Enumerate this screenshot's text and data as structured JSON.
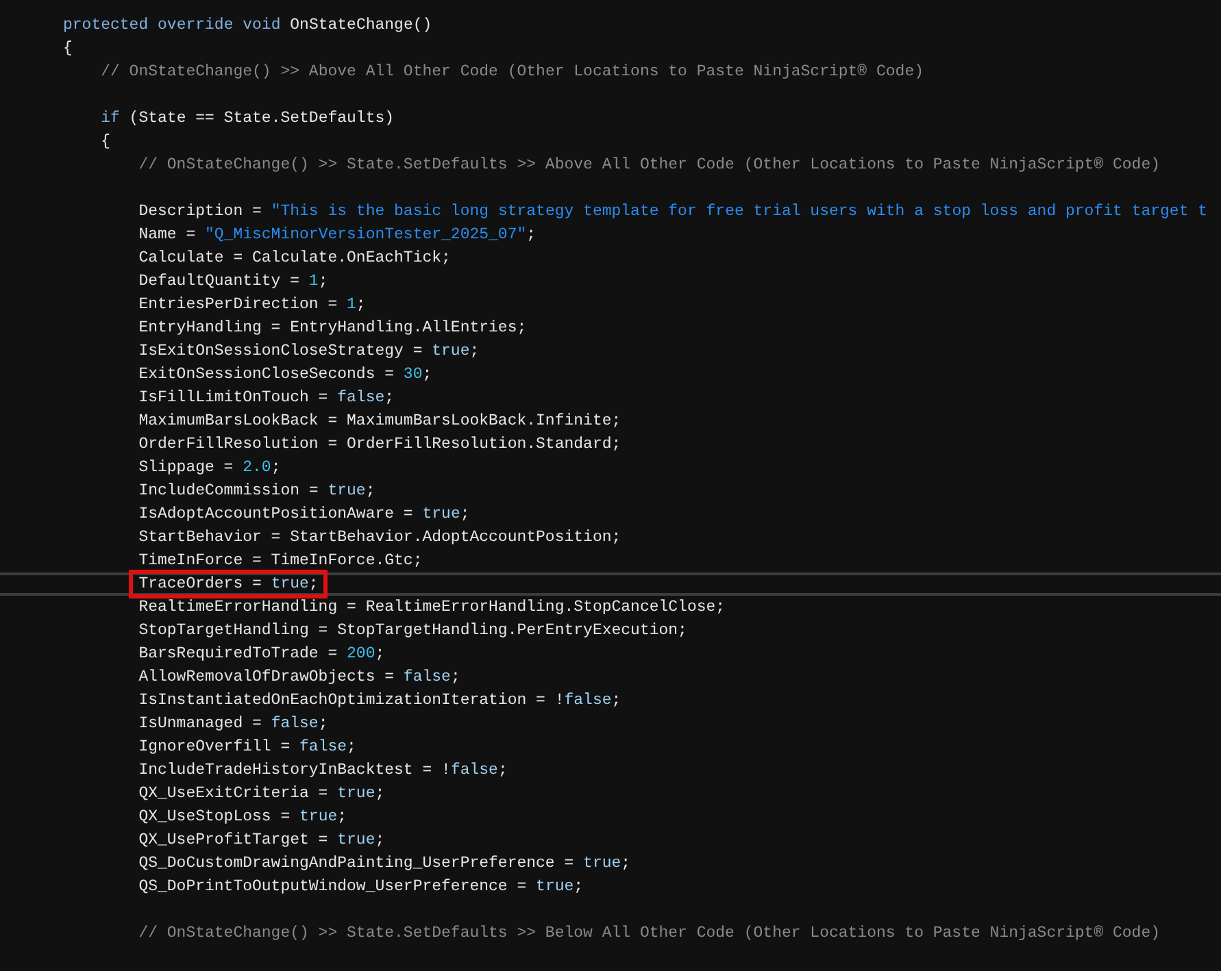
{
  "editor": {
    "lines": [
      {
        "kind": "code",
        "current": false,
        "marked": false,
        "tokens": [
          {
            "kind": "keyword",
            "text": "protected override void"
          },
          {
            "kind": "plain",
            "text": " OnStateChange()"
          }
        ]
      },
      {
        "kind": "code",
        "current": false,
        "marked": false,
        "tokens": [
          {
            "kind": "plain",
            "text": "{"
          }
        ],
        "children": [
          {
            "kind": "code",
            "current": false,
            "marked": false,
            "tokens": [
              {
                "kind": "comment",
                "text": "// OnStateChange() >> Above All Other Code (Other Locations to Paste NinjaScript® Code)"
              }
            ]
          },
          {
            "kind": "blank",
            "current": false,
            "marked": false
          },
          {
            "kind": "code",
            "current": false,
            "marked": false,
            "tokens": [
              {
                "kind": "keyword",
                "text": "if"
              },
              {
                "kind": "plain",
                "text": " (State == State.SetDefaults)"
              }
            ]
          },
          {
            "kind": "code",
            "current": false,
            "marked": false,
            "tokens": [
              {
                "kind": "plain",
                "text": "{"
              }
            ],
            "children": [
              {
                "kind": "code",
                "current": false,
                "marked": false,
                "tokens": [
                  {
                    "kind": "comment",
                    "text": "// OnStateChange() >> State.SetDefaults >> Above All Other Code (Other Locations to Paste NinjaScript® Code)"
                  }
                ]
              },
              {
                "kind": "blank",
                "current": false,
                "marked": false
              },
              {
                "kind": "code",
                "current": false,
                "marked": false,
                "tokens": [
                  {
                    "kind": "plain",
                    "text": "Description = "
                  },
                  {
                    "kind": "string",
                    "text": "\"This is the basic long strategy template for free trial users with a stop loss and profit target t"
                  }
                ]
              },
              {
                "kind": "code",
                "current": false,
                "marked": false,
                "tokens": [
                  {
                    "kind": "plain",
                    "text": "Name = "
                  },
                  {
                    "kind": "string",
                    "text": "\"Q_MiscMinorVersionTester_2025_07\""
                  },
                  {
                    "kind": "plain",
                    "text": ";"
                  }
                ]
              },
              {
                "kind": "code",
                "current": false,
                "marked": false,
                "tokens": [
                  {
                    "kind": "plain",
                    "text": "Calculate = Calculate.OnEachTick;"
                  }
                ]
              },
              {
                "kind": "code",
                "current": false,
                "marked": false,
                "tokens": [
                  {
                    "kind": "plain",
                    "text": "DefaultQuantity = "
                  },
                  {
                    "kind": "number",
                    "text": "1"
                  },
                  {
                    "kind": "plain",
                    "text": ";"
                  }
                ]
              },
              {
                "kind": "code",
                "current": false,
                "marked": false,
                "tokens": [
                  {
                    "kind": "plain",
                    "text": "EntriesPerDirection = "
                  },
                  {
                    "kind": "number",
                    "text": "1"
                  },
                  {
                    "kind": "plain",
                    "text": ";"
                  }
                ]
              },
              {
                "kind": "code",
                "current": false,
                "marked": false,
                "tokens": [
                  {
                    "kind": "plain",
                    "text": "EntryHandling = EntryHandling.AllEntries;"
                  }
                ]
              },
              {
                "kind": "code",
                "current": false,
                "marked": false,
                "tokens": [
                  {
                    "kind": "plain",
                    "text": "IsExitOnSessionCloseStrategy = "
                  },
                  {
                    "kind": "literal",
                    "text": "true"
                  },
                  {
                    "kind": "plain",
                    "text": ";"
                  }
                ]
              },
              {
                "kind": "code",
                "current": false,
                "marked": false,
                "tokens": [
                  {
                    "kind": "plain",
                    "text": "ExitOnSessionCloseSeconds = "
                  },
                  {
                    "kind": "number",
                    "text": "30"
                  },
                  {
                    "kind": "plain",
                    "text": ";"
                  }
                ]
              },
              {
                "kind": "code",
                "current": false,
                "marked": false,
                "tokens": [
                  {
                    "kind": "plain",
                    "text": "IsFillLimitOnTouch = "
                  },
                  {
                    "kind": "literal",
                    "text": "false"
                  },
                  {
                    "kind": "plain",
                    "text": ";"
                  }
                ]
              },
              {
                "kind": "code",
                "current": false,
                "marked": false,
                "tokens": [
                  {
                    "kind": "plain",
                    "text": "MaximumBarsLookBack = MaximumBarsLookBack.Infinite;"
                  }
                ]
              },
              {
                "kind": "code",
                "current": false,
                "marked": false,
                "tokens": [
                  {
                    "kind": "plain",
                    "text": "OrderFillResolution = OrderFillResolution.Standard;"
                  }
                ]
              },
              {
                "kind": "code",
                "current": false,
                "marked": false,
                "tokens": [
                  {
                    "kind": "plain",
                    "text": "Slippage = "
                  },
                  {
                    "kind": "number",
                    "text": "2.0"
                  },
                  {
                    "kind": "plain",
                    "text": ";"
                  }
                ]
              },
              {
                "kind": "code",
                "current": false,
                "marked": false,
                "tokens": [
                  {
                    "kind": "plain",
                    "text": "IncludeCommission = "
                  },
                  {
                    "kind": "literal",
                    "text": "true"
                  },
                  {
                    "kind": "plain",
                    "text": ";"
                  }
                ]
              },
              {
                "kind": "code",
                "current": false,
                "marked": false,
                "tokens": [
                  {
                    "kind": "plain",
                    "text": "IsAdoptAccountPositionAware = "
                  },
                  {
                    "kind": "literal",
                    "text": "true"
                  },
                  {
                    "kind": "plain",
                    "text": ";"
                  }
                ]
              },
              {
                "kind": "code",
                "current": false,
                "marked": false,
                "tokens": [
                  {
                    "kind": "plain",
                    "text": "StartBehavior = StartBehavior.AdoptAccountPosition;"
                  }
                ]
              },
              {
                "kind": "code",
                "current": false,
                "marked": false,
                "tokens": [
                  {
                    "kind": "plain",
                    "text": "TimeInForce = TimeInForce.Gtc;"
                  }
                ]
              },
              {
                "kind": "code",
                "current": true,
                "marked": true,
                "tokens": [
                  {
                    "kind": "plain",
                    "text": "TraceOrders = "
                  },
                  {
                    "kind": "literal",
                    "text": "true"
                  },
                  {
                    "kind": "plain",
                    "text": ";"
                  }
                ]
              },
              {
                "kind": "code",
                "current": false,
                "marked": false,
                "tokens": [
                  {
                    "kind": "plain",
                    "text": "RealtimeErrorHandling = RealtimeErrorHandling.StopCancelClose;"
                  }
                ]
              },
              {
                "kind": "code",
                "current": false,
                "marked": false,
                "tokens": [
                  {
                    "kind": "plain",
                    "text": "StopTargetHandling = StopTargetHandling.PerEntryExecution;"
                  }
                ]
              },
              {
                "kind": "code",
                "current": false,
                "marked": false,
                "tokens": [
                  {
                    "kind": "plain",
                    "text": "BarsRequiredToTrade = "
                  },
                  {
                    "kind": "number",
                    "text": "200"
                  },
                  {
                    "kind": "plain",
                    "text": ";"
                  }
                ]
              },
              {
                "kind": "code",
                "current": false,
                "marked": false,
                "tokens": [
                  {
                    "kind": "plain",
                    "text": "AllowRemovalOfDrawObjects = "
                  },
                  {
                    "kind": "literal",
                    "text": "false"
                  },
                  {
                    "kind": "plain",
                    "text": ";"
                  }
                ]
              },
              {
                "kind": "code",
                "current": false,
                "marked": false,
                "tokens": [
                  {
                    "kind": "plain",
                    "text": "IsInstantiatedOnEachOptimizationIteration = !"
                  },
                  {
                    "kind": "literal",
                    "text": "false"
                  },
                  {
                    "kind": "plain",
                    "text": ";"
                  }
                ]
              },
              {
                "kind": "code",
                "current": false,
                "marked": false,
                "tokens": [
                  {
                    "kind": "plain",
                    "text": "IsUnmanaged = "
                  },
                  {
                    "kind": "literal",
                    "text": "false"
                  },
                  {
                    "kind": "plain",
                    "text": ";"
                  }
                ]
              },
              {
                "kind": "code",
                "current": false,
                "marked": false,
                "tokens": [
                  {
                    "kind": "plain",
                    "text": "IgnoreOverfill = "
                  },
                  {
                    "kind": "literal",
                    "text": "false"
                  },
                  {
                    "kind": "plain",
                    "text": ";"
                  }
                ]
              },
              {
                "kind": "code",
                "current": false,
                "marked": false,
                "tokens": [
                  {
                    "kind": "plain",
                    "text": "IncludeTradeHistoryInBacktest = !"
                  },
                  {
                    "kind": "literal",
                    "text": "false"
                  },
                  {
                    "kind": "plain",
                    "text": ";"
                  }
                ]
              },
              {
                "kind": "code",
                "current": false,
                "marked": false,
                "tokens": [
                  {
                    "kind": "plain",
                    "text": "QX_UseExitCriteria = "
                  },
                  {
                    "kind": "literal",
                    "text": "true"
                  },
                  {
                    "kind": "plain",
                    "text": ";"
                  }
                ]
              },
              {
                "kind": "code",
                "current": false,
                "marked": false,
                "tokens": [
                  {
                    "kind": "plain",
                    "text": "QX_UseStopLoss = "
                  },
                  {
                    "kind": "literal",
                    "text": "true"
                  },
                  {
                    "kind": "plain",
                    "text": ";"
                  }
                ]
              },
              {
                "kind": "code",
                "current": false,
                "marked": false,
                "tokens": [
                  {
                    "kind": "plain",
                    "text": "QX_UseProfitTarget = "
                  },
                  {
                    "kind": "literal",
                    "text": "true"
                  },
                  {
                    "kind": "plain",
                    "text": ";"
                  }
                ]
              },
              {
                "kind": "code",
                "current": false,
                "marked": false,
                "tokens": [
                  {
                    "kind": "plain",
                    "text": "QS_DoCustomDrawingAndPainting_UserPreference = "
                  },
                  {
                    "kind": "literal",
                    "text": "true"
                  },
                  {
                    "kind": "plain",
                    "text": ";"
                  }
                ]
              },
              {
                "kind": "code",
                "current": false,
                "marked": false,
                "tokens": [
                  {
                    "kind": "plain",
                    "text": "QS_DoPrintToOutputWindow_UserPreference = "
                  },
                  {
                    "kind": "literal",
                    "text": "true"
                  },
                  {
                    "kind": "plain",
                    "text": ";"
                  }
                ]
              },
              {
                "kind": "blank",
                "current": false,
                "marked": false
              },
              {
                "kind": "code",
                "current": false,
                "marked": false,
                "tokens": [
                  {
                    "kind": "comment",
                    "text": "// OnStateChange() >> State.SetDefaults >> Below All Other Code (Other Locations to Paste NinjaScript® Code)"
                  }
                ]
              }
            ]
          }
        ]
      }
    ]
  }
}
